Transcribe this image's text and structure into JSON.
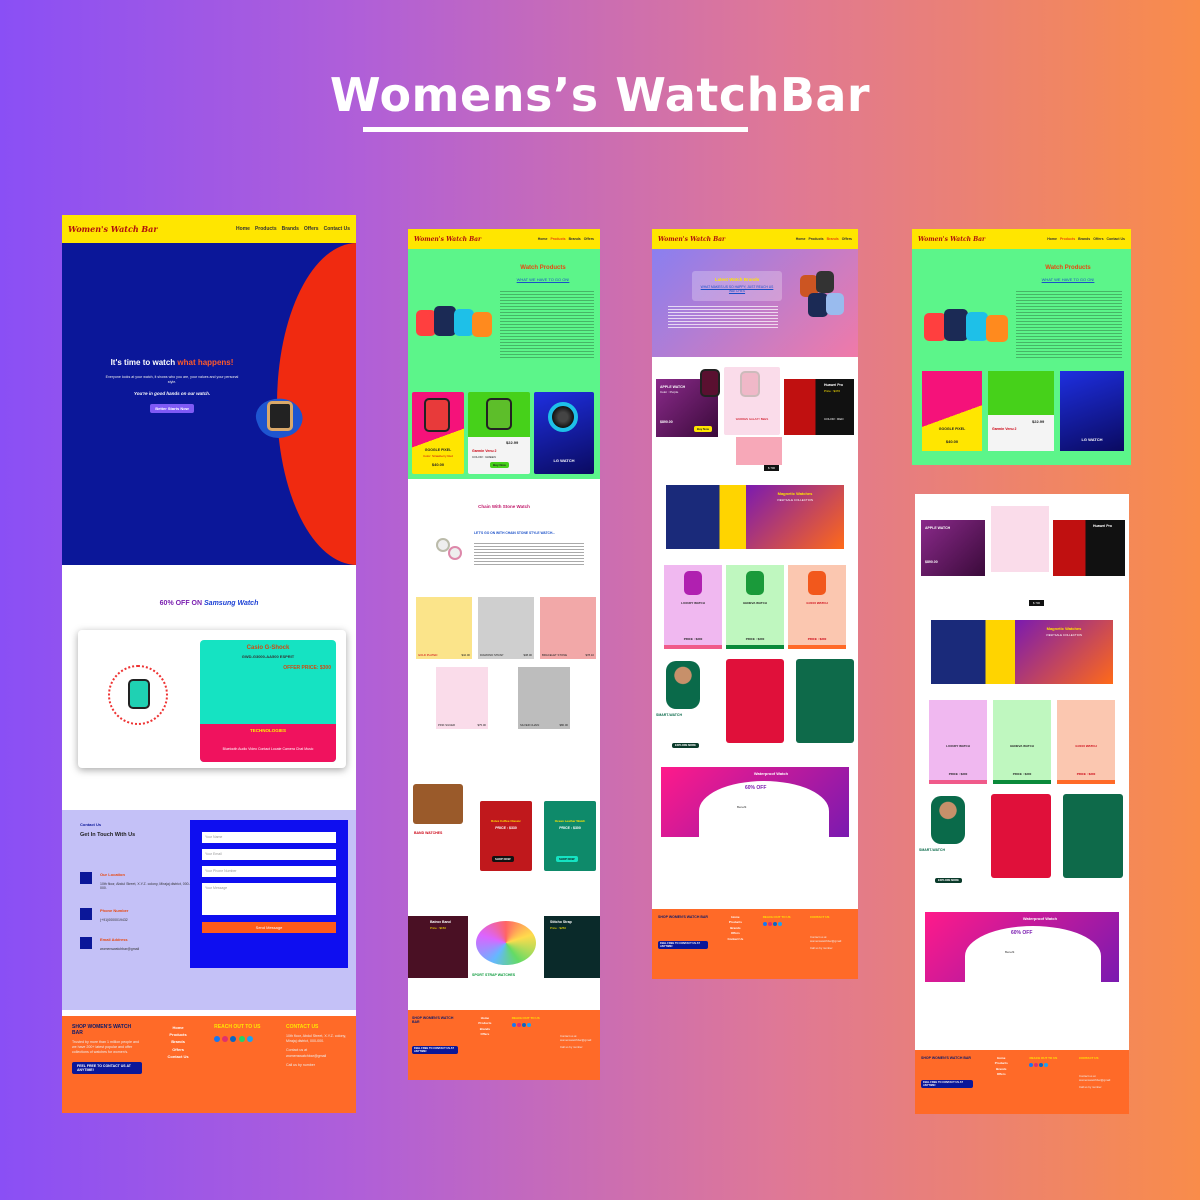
{
  "headline": "Womens’s WatchBar",
  "logo_text": "Women's Watch Bar",
  "nav": [
    "Home",
    "Products",
    "Brands",
    "Offers",
    "Contact Us"
  ],
  "home": {
    "hero_title_a": "It's time to watch",
    "hero_title_b": "what happens!",
    "hero_body": "Everyone looks at your watch, it shows who you are, your values and your personal style.",
    "hero_tagline": "You're in good hands on our watch.",
    "hero_button": "Better Starts Now",
    "offer_title_a": "60% OFF ON",
    "offer_title_b": "Samsung Watch",
    "offer_card_title": "Casio G-Shock",
    "offer_card_model": "GWD-G3000-AA500 ESPRIT",
    "offer_price": "OFFER PRICE: $300",
    "tech_label": "TECHNOLOGIES",
    "tech_items": "Bluetooth Audio  Video  Contact  Locate  Camera  Chat  Music",
    "contact_tag": "Contact Us",
    "contact_title": "Get In Touch With Us",
    "location_label": "Our Location",
    "location_value": "10th floor, Abdul Street, X.Y.Z. colony, Mirajaj district, 000-000.",
    "phone_label": "Phone Number",
    "phone_value": "(+91)0000019432",
    "email_label": "Email Address",
    "email_value": "womenswatchbar@gmail",
    "field_name": "Your Name",
    "field_email": "Your Email",
    "field_phone": "Your Phone Number",
    "field_message": "Your Message",
    "send_button": "Send Message"
  },
  "footer": {
    "shop_title": "SHOP WOMEN'S WATCH BAR",
    "shop_body": "Trusted by more than 1 million people and we have 200+ latest popular and offer collections of watches for women's.",
    "cta": "FEEL FREE TO CONTACT US AT ANYTIME!",
    "links": [
      "Home",
      "Products",
      "Brands",
      "Offers",
      "Contact Us"
    ],
    "reach_title": "REACH OUT TO US",
    "contact_title": "CONTACT US",
    "address": "10th floor, Abdul Street, X.Y.Z. colony, Mirajaj district, 000-000.",
    "mail_line": "Contact us at womenswatchbar@gmail",
    "call_line": "Call us by number"
  },
  "products": {
    "title": "Watch Products",
    "subtitle": "WHAT WE HAVE TO GO ON!",
    "card1_name": "GOOGLE PIXEL",
    "card1_sub": "Color: Strawberry Red",
    "card1_price": "$40.00",
    "card2_name": "Garmin Venu 2",
    "card2_color": "COLOR : GREEN",
    "card2_price": "$22.99",
    "card2_btn": "Buy Now",
    "card3_name": "LG WATCH",
    "chain_title": "Chain With Stone Watch",
    "chain_sub": "LET'S GO ON WITH CHAIN STONE STYLE WATCH...",
    "chain_items": [
      "GOLD PLATED",
      "DIAMOND STRAP",
      "BRACELET STONE",
      "PINK SILVER",
      "SILVER CHAIN"
    ],
    "chain_prices": [
      "$42.00",
      "$38.00",
      "$78.10",
      "$75.00",
      "$80.00"
    ],
    "band_title": "BAND WATCHES",
    "rolex_name": "Rolex Coffee Classic",
    "rolex_price": "PRICE : $330",
    "ocean_name": "Ocean Leather Watch",
    "ocean_price": "PRICE : $300",
    "shop_now": "SHOP NOW",
    "batrox": "Batrox Band",
    "batrox_price": "Price : $150",
    "stitcho": "Stitcho Strap",
    "stitcho_price": "Price : $250",
    "sport_title": "SPORT STRAP WATCHES"
  },
  "brands": {
    "title": "Latest Watch Brands",
    "subtitle": "WHAT MAKES US SO HAPPY, JUST REACH US WATCHES",
    "apple": "APPLE WATCH",
    "apple_color": "Color : Purple",
    "apple_price": "$890.00",
    "buy_now": "Buy Now",
    "huawei": "Huawei Pro",
    "huawei_price": "Price : $470",
    "huawei_color": "COLOR : RED",
    "warren": "WARREN GALAXY BEES",
    "warren_price": "$ 700",
    "magnetic": "Magnetic Watches",
    "magnetic_sub": "VIEW SALE COLLECTION",
    "luxury": "LUXURY WATCH",
    "geneva": "GENEVA WATCH",
    "gucci": "GUCCI WATCH",
    "luxury_price": "PRICE : $300",
    "geneva_price": "PRICE : $300",
    "gucci_price": "PRICE : $300",
    "smart": "SMART-WATCH",
    "explore": "EXPLORE MORE",
    "waterproof": "Waterproof Watch",
    "off": "60% OFF",
    "benefit": "Benefit"
  },
  "colors": {
    "yellow": "#ffe600",
    "green": "#5cf58a",
    "orange": "#ff6a28",
    "navy": "#0b1799",
    "red": "#f02a10",
    "purple": "#7f3dea"
  }
}
